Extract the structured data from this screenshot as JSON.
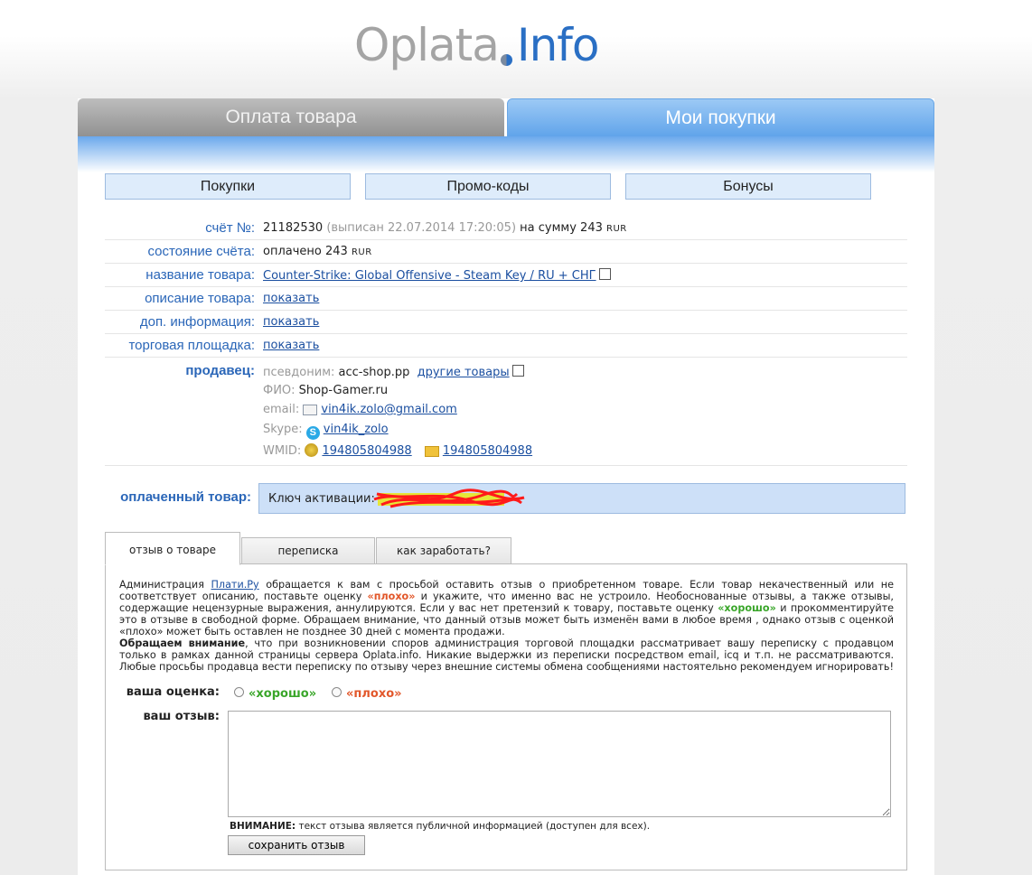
{
  "logo": {
    "part1": "Oplata",
    "part2": "Info"
  },
  "main_tabs": {
    "pay": "Оплата товара",
    "my": "Мои покупки"
  },
  "sub_tabs": [
    "Покупки",
    "Промо-коды",
    "Бонусы"
  ],
  "invoice": {
    "labels": {
      "number": "счёт №:",
      "status": "состояние счёта:",
      "product": "название товара:",
      "description": "описание товара:",
      "extra": "доп. информация:",
      "marketplace": "торговая площадка:",
      "seller": "продавец:"
    },
    "number": "21182530",
    "issued": "(выписан 22.07.2014 17:20:05)",
    "sum_prefix": "на сумму 243",
    "currency": "RUR",
    "status_text": "оплачено 243",
    "product_name": "Counter-Strike: Global Offensive - Steam Key / RU + СНГ",
    "show_link": "показать"
  },
  "seller": {
    "pseudonym_label": "псевдоним:",
    "pseudonym": "acc-shop.pp",
    "other_goods": "другие товары",
    "fio_label": "ФИО:",
    "fio": "Shop-Gamer.ru",
    "email_label": "email:",
    "email": "vin4ik.zolo@gmail.com",
    "skype_label": "Skype:",
    "skype": "vin4ik_zolo",
    "wmid_label": "WMID:",
    "wmid": "194805804988",
    "wmid2": "194805804988"
  },
  "paid": {
    "label": "оплаченный товар:",
    "prefix": "Ключ активации:"
  },
  "review_tabs": [
    "отзыв о товаре",
    "переписка",
    "как заработать?"
  ],
  "review": {
    "p1_a": "Администрация",
    "p1_link": "Плати.Ру",
    "p1_b": "обращается к вам с просьбой оставить отзыв о приобретенном товаре. Если товар некачественный или не соответствует описанию, поставьте оценку",
    "bad_word": "«плохо»",
    "p1_c": "и укажите, что именно вас не устроило. Необоснованные отзывы, а также отзывы, содержащие нецензурные выражения, аннулируются. Если у вас нет претензий к товару, поставьте оценку",
    "good_word": "«хорошо»",
    "p1_d": "и прокомментируйте это в отзыве в свободной форме. Обращаем внимание, что данный отзыв может быть изменён вами в любое время , однако отзыв с оценкой «плохо» может быть оставлен не позднее 30 дней с момента продажи.",
    "p2_bold": "Обращаем внимание",
    "p2_rest": ", что при возникновении споров администрация торговой площадки рассматривает вашу переписку с продавцом только в рамках данной страницы сервера Oplata.info. Никакие выдержки из переписки посредством email, icq и т.п. не рассматриваются. Любые просьбы продавца вести переписку по отзыву через внешние системы обмена сообщениями настоятельно рекомендуем игнорировать!",
    "rating_label": "ваша оценка:",
    "rating_good": "«хорошо»",
    "rating_bad": "«плохо»",
    "feedback_label": "ваш отзыв:",
    "feedback_value": "",
    "warning_bold": "ВНИМАНИЕ:",
    "warning_text": "текст отзыва является публичной информацией (доступен для всех).",
    "save_button": "сохранить отзыв"
  },
  "colors": {
    "accent": "#2a66b8",
    "good": "#3aa62a",
    "bad": "#e2572a",
    "active_tab": "#5fa3ea"
  }
}
